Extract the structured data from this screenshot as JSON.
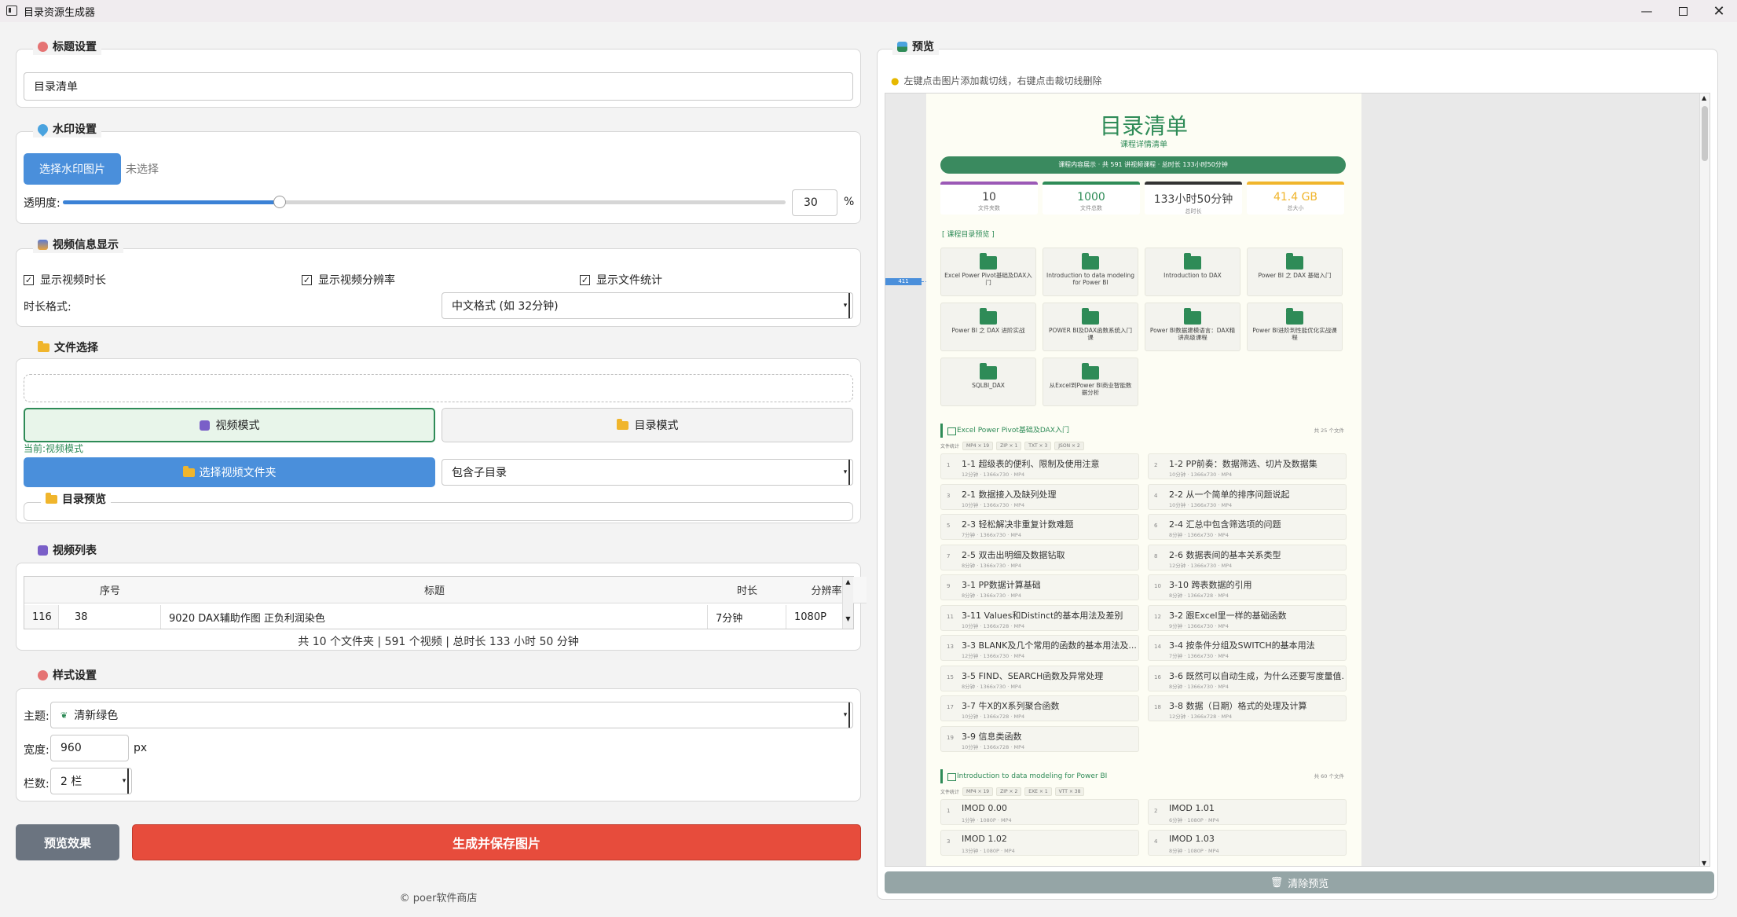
{
  "window": {
    "title": "目录资源生成器"
  },
  "title_group": {
    "label": "标题设置",
    "value": "目录清单"
  },
  "watermark": {
    "label": "水印设置",
    "choose_btn": "选择水印图片",
    "status": "未选择",
    "opacity_label": "透明度:",
    "opacity_value": "30",
    "opacity_unit": "%",
    "opacity_level": 30
  },
  "video_info": {
    "label": "视频信息显示",
    "show_duration": "显示视频时长",
    "show_resolution": "显示视频分辨率",
    "show_stats": "显示文件统计",
    "duration_format_label": "时长格式:",
    "duration_format": "中文格式 (如 32分钟)"
  },
  "file_select": {
    "label": "文件选择",
    "video_mode": "视频模式",
    "dir_mode": "目录模式",
    "current_prefix": "当前:",
    "current_mode": "视频模式",
    "choose_folder": "选择视频文件夹",
    "subdir": "包含子目录",
    "dir_preview": "目录预览"
  },
  "video_list": {
    "label": "视频列表",
    "columns": [
      "序号",
      "标题",
      "时长",
      "分辨率"
    ],
    "row": {
      "index": "116",
      "num": "38",
      "title": "9020 DAX辅助作图 正负利润染色",
      "duration": "7分钟",
      "resolution": "1080P"
    },
    "summary": "共 10 个文件夹 | 591 个视频 | 总时长 133 小时 50 分钟"
  },
  "style": {
    "label": "样式设置",
    "theme_label": "主题:",
    "theme": "清新绿色",
    "width_label": "宽度:",
    "width": "960",
    "width_unit": "px",
    "cols_label": "栏数:",
    "cols": "2 栏"
  },
  "actions": {
    "preview": "预览效果",
    "generate": "生成并保存图片"
  },
  "footer": "© poer软件商店",
  "preview": {
    "label": "预览",
    "hint": "左键点击图片添加裁切线，右键点击裁切线删除",
    "marker": "411",
    "clear": "清除预览",
    "doc": {
      "title": "目录清单",
      "subtitle": "课程详情清单",
      "banner": "课程内容展示 · 共 591 讲视频课程 · 总时长 133小时50分钟",
      "stats": [
        {
          "value": "10",
          "label": "文件夹数",
          "color": "#9b59b6"
        },
        {
          "value": "1000",
          "label": "文件总数",
          "color": "#2e8b57"
        },
        {
          "value": "133小时50分钟",
          "label": "总时长",
          "color": "#333333"
        },
        {
          "value": "41.4 GB",
          "label": "总大小",
          "color": "#f0b52c"
        }
      ],
      "section_title": "[ 课程目录预览 ]",
      "folders": [
        "Excel Power Pivot基础及DAX入门",
        "Introduction to data modeling for Power BI",
        "Introduction to DAX",
        "Power BI 之 DAX 基础入门",
        "Power BI 之 DAX 进阶实战",
        "POWER BI及DAX函数系统入门课",
        "Power BI数据建模语言：DAX精讲高级课程",
        "Power BI进阶到性能优化实战课程",
        "SQLBI_DAX",
        "从Excel到Power BI商业智能数据分析"
      ],
      "sec1": {
        "title": "Excel Power Pivot基础及DAX入门",
        "count": "共 25 个文件",
        "tags_label": "文件统计",
        "tags": [
          "MP4 × 19",
          "ZIP × 1",
          "TXT × 3",
          "JSON × 2"
        ],
        "items": [
          {
            "n": "1",
            "t": "1-1 超级表的便利、限制及使用注意",
            "m": "12分钟 · 1366x730 · MP4"
          },
          {
            "n": "2",
            "t": "1-2 PP前奏：数据筛选、切片及数据集",
            "m": "10分钟 · 1366x730 · MP4"
          },
          {
            "n": "3",
            "t": "2-1 数据接入及缺列处理",
            "m": "10分钟 · 1366x730 · MP4"
          },
          {
            "n": "4",
            "t": "2-2 从一个简单的排序问题说起",
            "m": "10分钟 · 1366x730 · MP4"
          },
          {
            "n": "5",
            "t": "2-3 轻松解决非重复计数难题",
            "m": "7分钟 · 1366x730 · MP4"
          },
          {
            "n": "6",
            "t": "2-4 汇总中包含筛选项的问题",
            "m": "8分钟 · 1366x730 · MP4"
          },
          {
            "n": "7",
            "t": "2-5 双击出明细及数据钻取",
            "m": "8分钟 · 1366x730 · MP4"
          },
          {
            "n": "8",
            "t": "2-6 数据表间的基本关系类型",
            "m": "12分钟 · 1366x730 · MP4"
          },
          {
            "n": "9",
            "t": "3-1 PP数据计算基础",
            "m": "8分钟 · 1366x730 · MP4"
          },
          {
            "n": "10",
            "t": "3-10 跨表数据的引用",
            "m": "8分钟 · 1366x728 · MP4"
          },
          {
            "n": "11",
            "t": "3-11 Values和Distinct的基本用法及差别",
            "m": "10分钟 · 1366x728 · MP4"
          },
          {
            "n": "12",
            "t": "3-2 跟Excel里一样的基础函数",
            "m": "9分钟 · 1366x730 · MP4"
          },
          {
            "n": "13",
            "t": "3-3 BLANK及几个常用的函数的基本用法及...",
            "m": "12分钟 · 1366x730 · MP4"
          },
          {
            "n": "14",
            "t": "3-4 按条件分组及SWITCH的基本用法",
            "m": "7分钟 · 1366x730 · MP4"
          },
          {
            "n": "15",
            "t": "3-5 FIND、SEARCH函数及异常处理",
            "m": "8分钟 · 1366x730 · MP4"
          },
          {
            "n": "16",
            "t": "3-6 既然可以自动生成，为什么还要写度量值...",
            "m": "8分钟 · 1366x730 · MP4"
          },
          {
            "n": "17",
            "t": "3-7 牛X的X系列聚合函数",
            "m": "10分钟 · 1366x728 · MP4"
          },
          {
            "n": "18",
            "t": "3-8 数据（日期）格式的处理及计算",
            "m": "12分钟 · 1366x728 · MP4"
          },
          {
            "n": "19",
            "t": "3-9 信息类函数",
            "m": "10分钟 · 1366x728 · MP4"
          }
        ]
      },
      "sec2": {
        "title": "Introduction to data modeling for Power BI",
        "count": "共 60 个文件",
        "tags_label": "文件统计",
        "tags": [
          "MP4 × 19",
          "ZIP × 2",
          "EXE × 1",
          "VTT × 38"
        ],
        "items": [
          {
            "n": "1",
            "t": "IMOD 0.00",
            "m": "1分钟 · 1080P · MP4"
          },
          {
            "n": "2",
            "t": "IMOD 1.01",
            "m": "6分钟 · 1080P · MP4"
          },
          {
            "n": "3",
            "t": "IMOD 1.02",
            "m": "13分钟 · 1080P · MP4"
          },
          {
            "n": "4",
            "t": "IMOD 1.03",
            "m": "8分钟 · 1080P · MP4"
          }
        ]
      }
    }
  }
}
